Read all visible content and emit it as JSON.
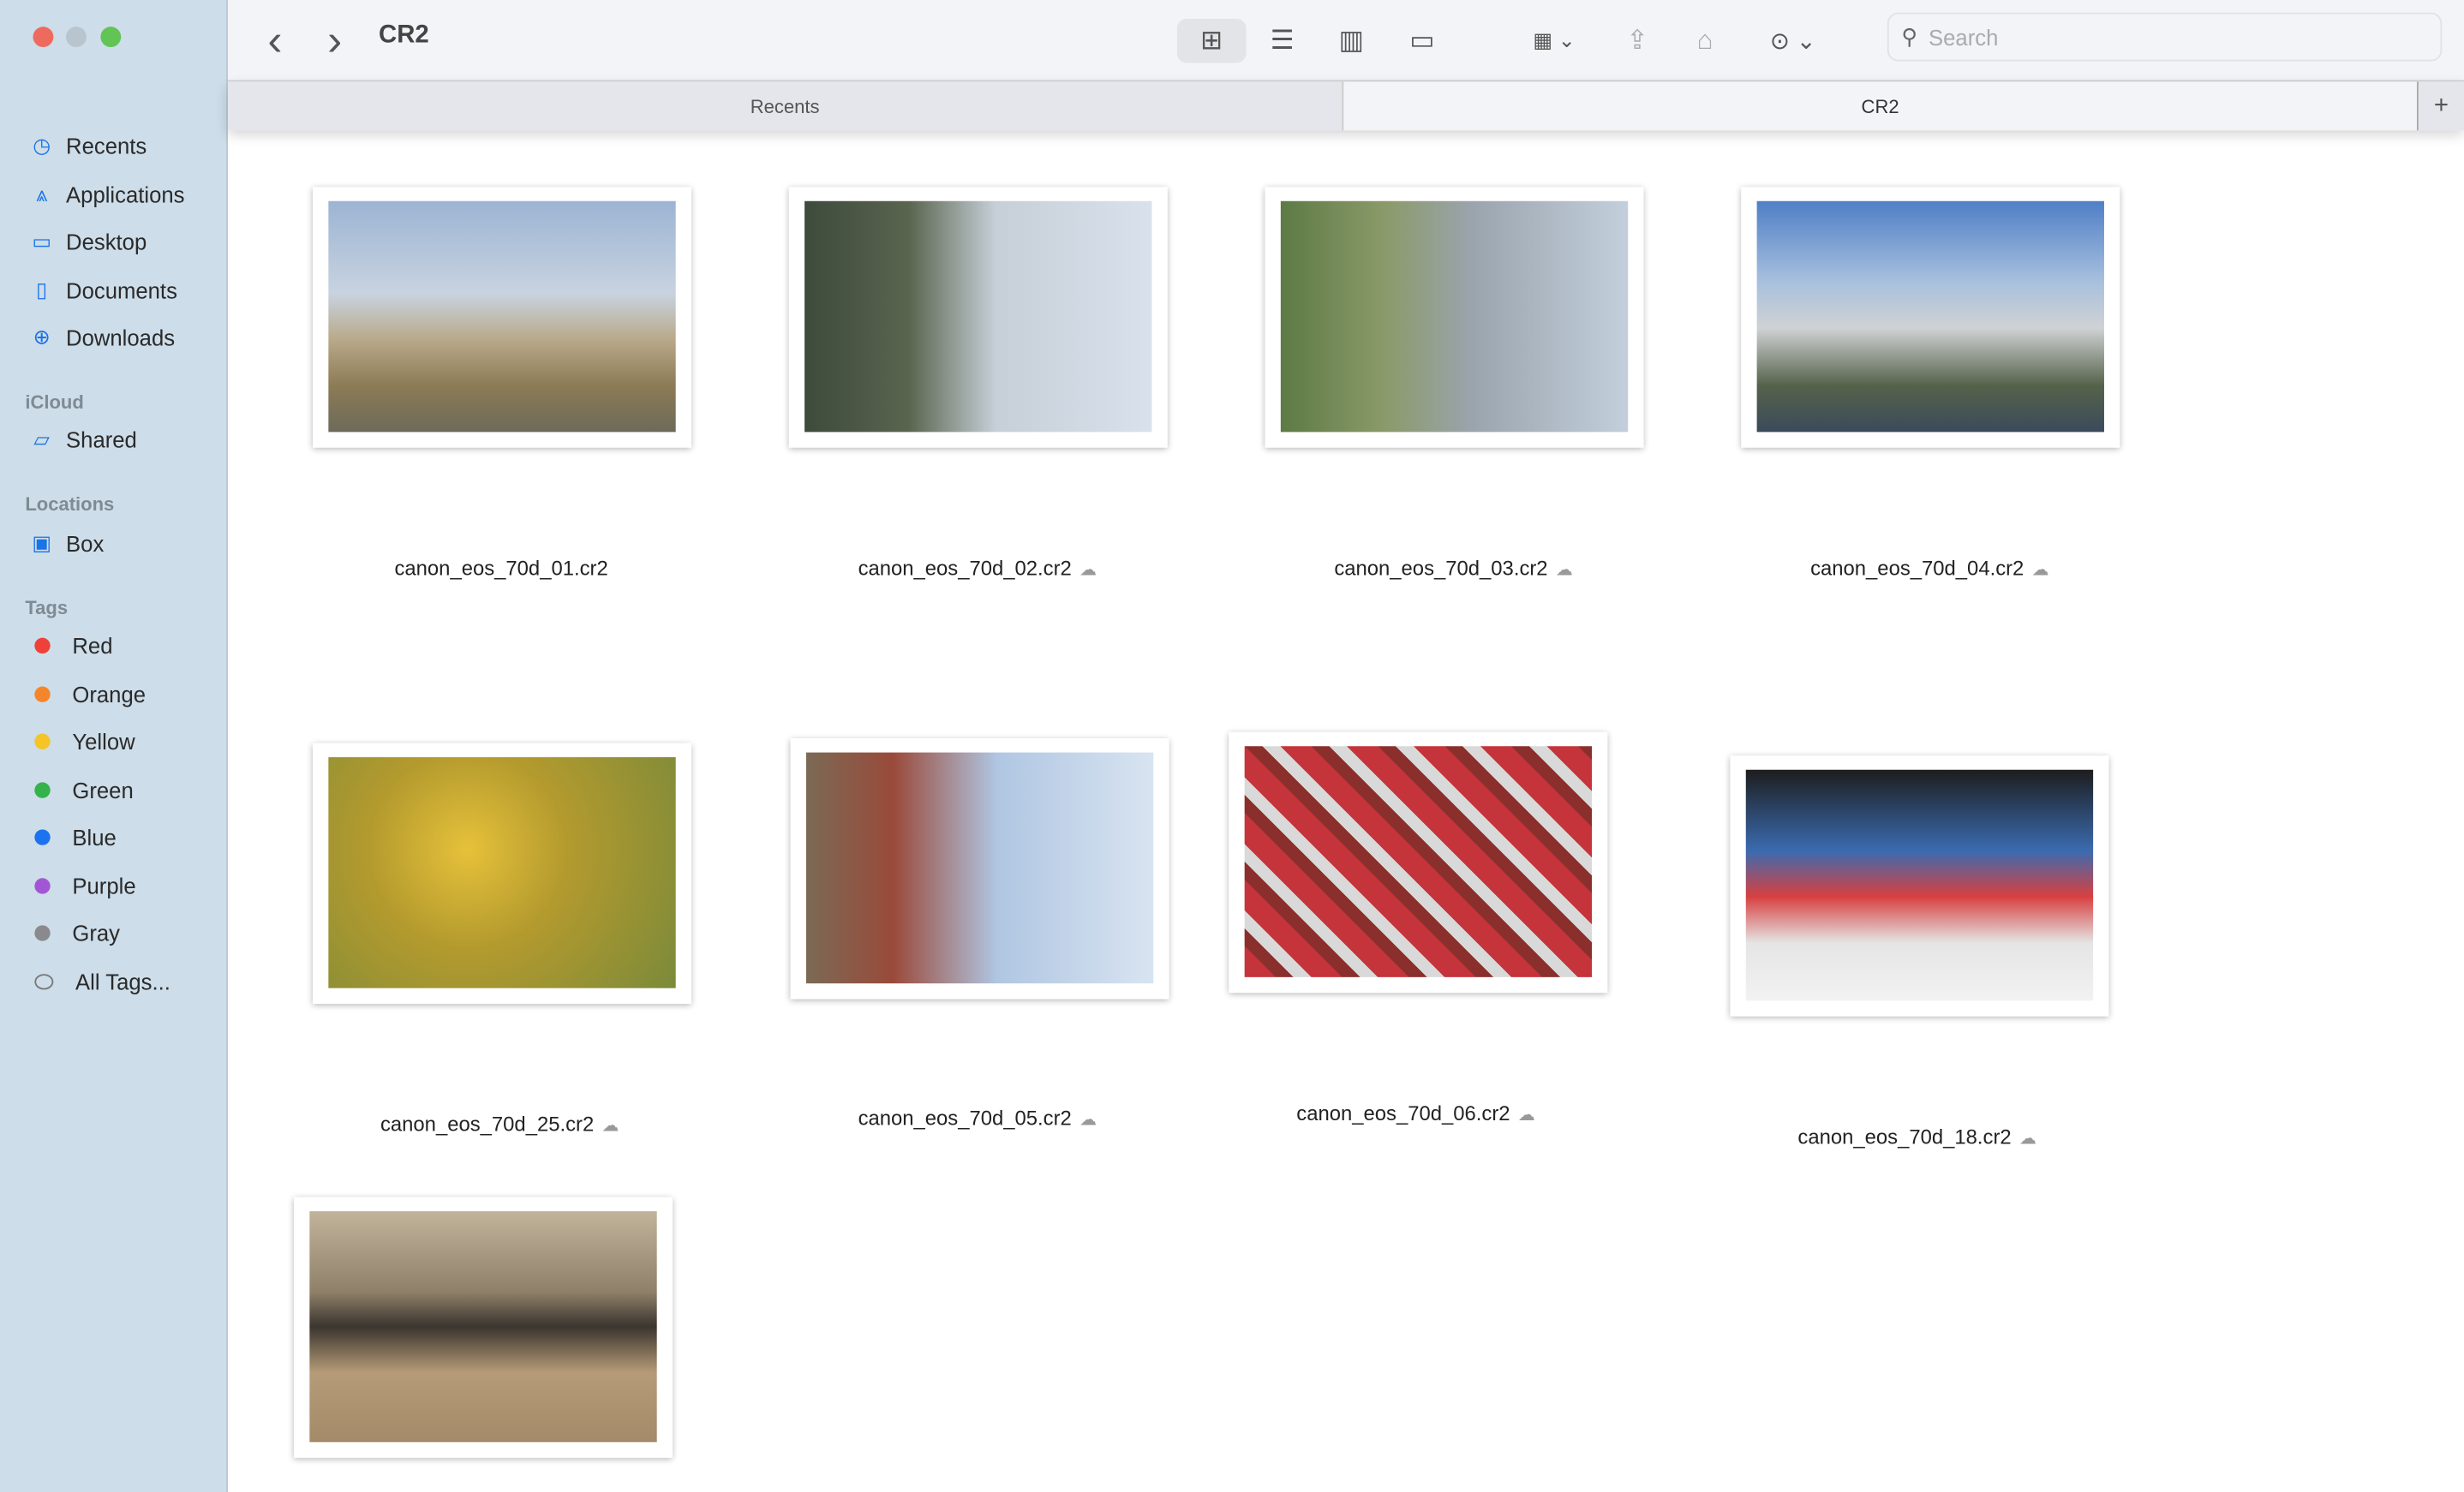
{
  "window": {
    "title": "CR2"
  },
  "toolbar": {
    "back": "‹",
    "forward": "›",
    "search_placeholder": "Search",
    "icons": [
      "icon-view-grid",
      "list-view",
      "column-view",
      "gallery-view",
      "group-by",
      "share",
      "tag",
      "more-actions"
    ]
  },
  "tabs": [
    {
      "label": "Recents",
      "active": false
    },
    {
      "label": "CR2",
      "active": true
    }
  ],
  "new_tab": "+",
  "sidebar": {
    "favorites": [
      {
        "label": "Recents",
        "icon": "clock"
      },
      {
        "label": "Applications",
        "icon": "apps"
      },
      {
        "label": "Desktop",
        "icon": "desktop"
      },
      {
        "label": "Documents",
        "icon": "document"
      },
      {
        "label": "Downloads",
        "icon": "download"
      }
    ],
    "icloud_header": "iCloud",
    "icloud": [
      {
        "label": "Shared",
        "icon": "shared-folder"
      }
    ],
    "locations_header": "Locations",
    "locations": [
      {
        "label": "Box",
        "icon": "box"
      }
    ],
    "tags_header": "Tags",
    "tags": [
      {
        "label": "Red",
        "color": "#f0403a"
      },
      {
        "label": "Orange",
        "color": "#f4852a"
      },
      {
        "label": "Yellow",
        "color": "#f5c526"
      },
      {
        "label": "Green",
        "color": "#33b34a"
      },
      {
        "label": "Blue",
        "color": "#1b73f0"
      },
      {
        "label": "Purple",
        "color": "#a356d4"
      },
      {
        "label": "Gray",
        "color": "#8a8a8e"
      },
      {
        "label": "All Tags...",
        "color": ""
      }
    ]
  },
  "files": [
    {
      "name": "canon_eos_70d_01.cr2",
      "cloud": false
    },
    {
      "name": "canon_eos_70d_02.cr2",
      "cloud": true
    },
    {
      "name": "canon_eos_70d_03.cr2",
      "cloud": true
    },
    {
      "name": "canon_eos_70d_04.cr2",
      "cloud": true
    },
    {
      "name": "canon_eos_70d_25.cr2",
      "cloud": true
    },
    {
      "name": "canon_eos_70d_05.cr2",
      "cloud": true
    },
    {
      "name": "canon_eos_70d_06.cr2",
      "cloud": true
    },
    {
      "name": "canon_eos_70d_18.cr2",
      "cloud": true
    },
    {
      "name": "",
      "cloud": false
    }
  ]
}
